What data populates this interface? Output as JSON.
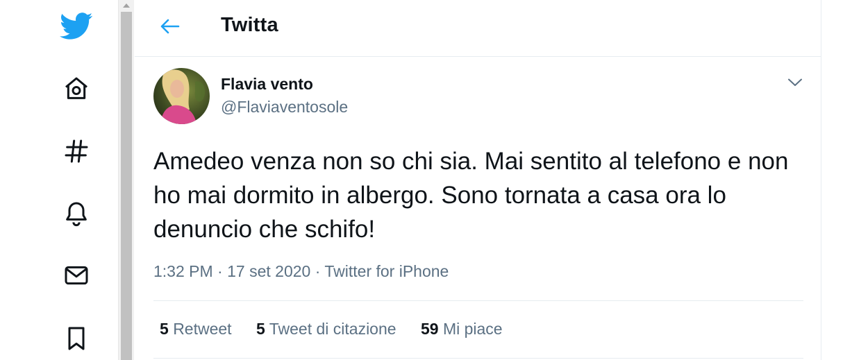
{
  "colors": {
    "accent": "#1da1f2",
    "text": "#0f1419",
    "muted": "#5b7083",
    "border": "#e6ecf0"
  },
  "nav": {
    "items": [
      {
        "name": "twitter-logo",
        "icon": "twitter-bird-icon"
      },
      {
        "name": "home",
        "icon": "home-icon"
      },
      {
        "name": "explore",
        "icon": "hashtag-icon"
      },
      {
        "name": "notifications",
        "icon": "bell-icon"
      },
      {
        "name": "messages",
        "icon": "mail-icon"
      },
      {
        "name": "bookmarks",
        "icon": "bookmark-icon"
      }
    ]
  },
  "header": {
    "title": "Twitta",
    "back_icon": "arrow-left-icon"
  },
  "tweet": {
    "author_name": "Flavia vento",
    "author_handle": "@Flaviaventosole",
    "text": "Amedeo venza non so chi sia. Mai sentito al telefono e non ho mai dormito in albergo. Sono tornata a casa ora lo denuncio che schifo!",
    "time": "1:32 PM",
    "separator": "·",
    "date": "17 set 2020",
    "source": "Twitter for iPhone"
  },
  "stats": {
    "retweets_count": "5",
    "retweets_label": "Retweet",
    "quotes_count": "5",
    "quotes_label": "Tweet di citazione",
    "likes_count": "59",
    "likes_label": "Mi piace"
  }
}
